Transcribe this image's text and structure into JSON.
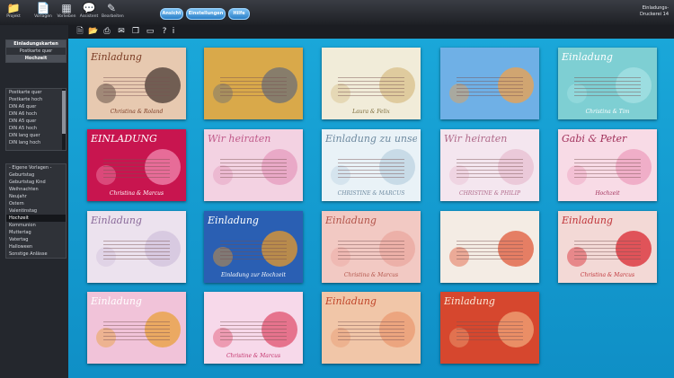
{
  "toolbar": {
    "items": [
      {
        "label": "Projekt",
        "icon": "folder-icon"
      },
      {
        "label": "Vorlagen",
        "icon": "document-icon"
      },
      {
        "label": "Vorlieben",
        "icon": "grid-icon"
      },
      {
        "label": "Assistent",
        "icon": "speech-bubble-icon"
      },
      {
        "label": "Bearbeiten",
        "icon": "brush-icon"
      }
    ],
    "pills": [
      "Ansicht",
      "Einstellungen",
      "Hilfe"
    ],
    "right_line1": "Einladungs-",
    "right_line2": "Druckerei 14"
  },
  "subtoolbar_icons": [
    "new-doc-icon",
    "open-folder-icon",
    "print-icon",
    "mail-icon",
    "copy-icon",
    "export-icon",
    "help-icon",
    "info-icon"
  ],
  "sidebar": {
    "section1": [
      {
        "label": "Einladungskarten",
        "style": "hl"
      },
      {
        "label": "Postkarte quer",
        "style": "center"
      },
      {
        "label": "Hochzeit",
        "style": "hl"
      }
    ],
    "section2": [
      "Postkarte quer",
      "Postkarte hoch",
      "DIN A6 quer",
      "DIN A6 hoch",
      "DIN A5 quer",
      "DIN A5 hoch",
      "DIN lang quer",
      "DIN lang hoch"
    ],
    "section3": [
      {
        "label": "- Eigene Vorlagen -",
        "style": ""
      },
      {
        "label": "Geburtstag",
        "style": ""
      },
      {
        "label": "Geburtstag Kind",
        "style": ""
      },
      {
        "label": "Weihnachten",
        "style": ""
      },
      {
        "label": "Neujahr",
        "style": ""
      },
      {
        "label": "Ostern",
        "style": ""
      },
      {
        "label": "Valentinstag",
        "style": ""
      },
      {
        "label": "Hochzeit",
        "style": "sel"
      },
      {
        "label": "Kommunion",
        "style": ""
      },
      {
        "label": "Muttertag",
        "style": ""
      },
      {
        "label": "Vatertag",
        "style": ""
      },
      {
        "label": "Halloween",
        "style": ""
      },
      {
        "label": "Sonstige Anlässe",
        "style": ""
      }
    ]
  },
  "cards": [
    {
      "title": "Einladung",
      "subtitle": "Christina & Roland",
      "bg": "#e7c9b0",
      "fg": "#7a3b24",
      "accent": "#4a3a34"
    },
    {
      "title": "",
      "subtitle": "",
      "bg": "#d9a94a",
      "fg": "#5a3a10",
      "accent": "#6b6f77"
    },
    {
      "title": "",
      "subtitle": "Laura & Felix",
      "bg": "#f1ecd9",
      "fg": "#7a6a3a",
      "accent": "#d8c08a"
    },
    {
      "title": "",
      "subtitle": "",
      "bg": "#6fb0e6",
      "fg": "#ffffff",
      "accent": "#f0a24a"
    },
    {
      "title": "Einladung",
      "subtitle": "Christina & Tim",
      "bg": "#7ecfd3",
      "fg": "#ffffff",
      "accent": "#a7e2e4"
    },
    {
      "title": "EINLADUNG",
      "subtitle": "Christina & Marcus",
      "bg": "#c8154f",
      "fg": "#ffffff",
      "accent": "#f28ab0"
    },
    {
      "title": "Wir heiraten",
      "subtitle": "",
      "bg": "#f3d2e2",
      "fg": "#c05a8a",
      "accent": "#e59bbd"
    },
    {
      "title": "Einladung zu unserer Hochzeit",
      "subtitle": "CHRISTINE & MARCUS",
      "bg": "#e9f2f7",
      "fg": "#6e8aa0",
      "accent": "#bcd3e2"
    },
    {
      "title": "Wir heiraten",
      "subtitle": "CHRISTINE & PHILIP",
      "bg": "#f4e6ef",
      "fg": "#b06a8a",
      "accent": "#e8bfd2"
    },
    {
      "title": "Gabi & Peter",
      "subtitle": "Hochzeit",
      "bg": "#f8dbe6",
      "fg": "#a0305a",
      "accent": "#ee9fbe"
    },
    {
      "title": "Einladung",
      "subtitle": "",
      "bg": "#ece2ee",
      "fg": "#8a6a9a",
      "accent": "#d2c2dc"
    },
    {
      "title": "Einladung",
      "subtitle": "Einladung zur Hochzeit",
      "bg": "#2a5fb3",
      "fg": "#ffffff",
      "accent": "#e89a2a"
    },
    {
      "title": "Einladung",
      "subtitle": "Christina & Marcus",
      "bg": "#f2c9c3",
      "fg": "#b2544a",
      "accent": "#eaa79f"
    },
    {
      "title": "",
      "subtitle": "",
      "bg": "#f4ece4",
      "fg": "#8a4a3a",
      "accent": "#e05a3a"
    },
    {
      "title": "Einladung",
      "subtitle": "Christina & Marcus",
      "bg": "#f3d9d6",
      "fg": "#c0353a",
      "accent": "#d9262f"
    },
    {
      "title": "Einladung",
      "subtitle": "",
      "bg": "#f1c3d9",
      "fg": "#ffffff",
      "accent": "#e8a03a"
    },
    {
      "title": "",
      "subtitle": "Christine & Marcus",
      "bg": "#f7d9ea",
      "fg": "#c2306a",
      "accent": "#e0506e"
    },
    {
      "title": "Einladung",
      "subtitle": "",
      "bg": "#f1c6a8",
      "fg": "#c0452a",
      "accent": "#e99a72"
    },
    {
      "title": "Einladung",
      "subtitle": "",
      "bg": "#d6472e",
      "fg": "#fbe7d6",
      "accent": "#f0a67a"
    }
  ]
}
